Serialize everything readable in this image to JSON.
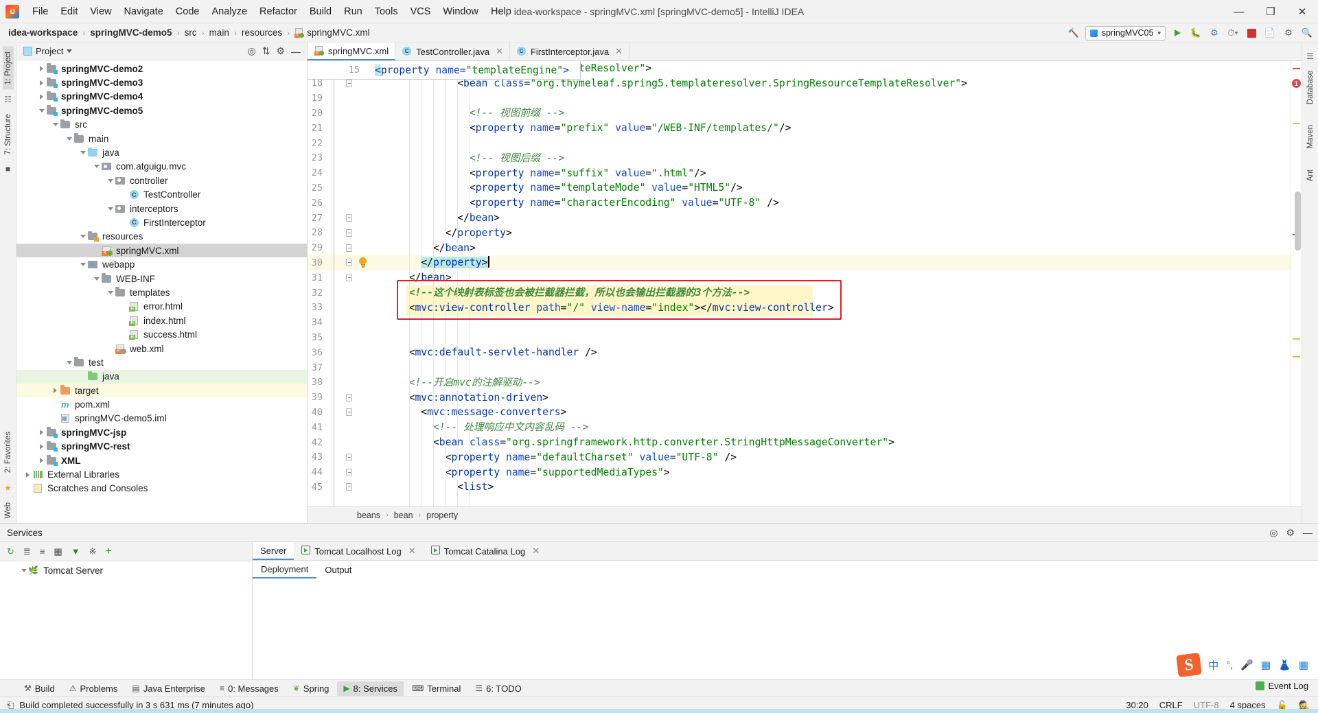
{
  "window": {
    "title": "idea-workspace - springMVC.xml [springMVC-demo5] - IntelliJ IDEA",
    "minimize": "—",
    "maximize": "❐",
    "close": "✕"
  },
  "menu": [
    "File",
    "Edit",
    "View",
    "Navigate",
    "Code",
    "Analyze",
    "Refactor",
    "Build",
    "Run",
    "Tools",
    "VCS",
    "Window",
    "Help"
  ],
  "breadcrumb": {
    "items": [
      "idea-workspace",
      "springMVC-demo5",
      "src",
      "main",
      "resources",
      "springMVC.xml"
    ],
    "separator": "›"
  },
  "run_config": {
    "name": "springMVC05",
    "chevron": "▾"
  },
  "left_strip": {
    "project_tab": "1: Project",
    "structure_tab": "7: Structure",
    "favorites_tab": "2: Favorites",
    "web_tab": "Web"
  },
  "right_strip": {
    "database_tab": "Database",
    "maven_tab": "Maven",
    "ant_tab": "Ant"
  },
  "project_panel": {
    "title": "Project",
    "tree": [
      {
        "label": "springMVC-demo2",
        "indent": 1,
        "arrow": "right",
        "icon": "module-folder",
        "bold": true,
        "state": ""
      },
      {
        "label": "springMVC-demo3",
        "indent": 1,
        "arrow": "right",
        "icon": "module-folder",
        "bold": true,
        "state": ""
      },
      {
        "label": "springMVC-demo4",
        "indent": 1,
        "arrow": "right",
        "icon": "module-folder",
        "bold": true,
        "state": ""
      },
      {
        "label": "springMVC-demo5",
        "indent": 1,
        "arrow": "down",
        "icon": "module-folder",
        "bold": true,
        "state": ""
      },
      {
        "label": "src",
        "indent": 2,
        "arrow": "down",
        "icon": "folder-gray",
        "bold": false,
        "state": ""
      },
      {
        "label": "main",
        "indent": 3,
        "arrow": "down",
        "icon": "folder-gray",
        "bold": false,
        "state": ""
      },
      {
        "label": "java",
        "indent": 4,
        "arrow": "down",
        "icon": "folder-blue",
        "bold": false,
        "state": ""
      },
      {
        "label": "com.atguigu.mvc",
        "indent": 5,
        "arrow": "down",
        "icon": "package",
        "bold": false,
        "state": ""
      },
      {
        "label": "controller",
        "indent": 6,
        "arrow": "down",
        "icon": "package",
        "bold": false,
        "state": ""
      },
      {
        "label": "TestController",
        "indent": 7,
        "arrow": "none",
        "icon": "class",
        "bold": false,
        "state": ""
      },
      {
        "label": "interceptors",
        "indent": 6,
        "arrow": "down",
        "icon": "package",
        "bold": false,
        "state": ""
      },
      {
        "label": "FirstInterceptor",
        "indent": 7,
        "arrow": "none",
        "icon": "class",
        "bold": false,
        "state": ""
      },
      {
        "label": "resources",
        "indent": 4,
        "arrow": "down",
        "icon": "folder-res",
        "bold": false,
        "state": ""
      },
      {
        "label": "springMVC.xml",
        "indent": 5,
        "arrow": "none",
        "icon": "xml-spring",
        "bold": false,
        "state": "selected"
      },
      {
        "label": "webapp",
        "indent": 4,
        "arrow": "down",
        "icon": "folder-web",
        "bold": false,
        "state": ""
      },
      {
        "label": "WEB-INF",
        "indent": 5,
        "arrow": "down",
        "icon": "folder-gray",
        "bold": false,
        "state": ""
      },
      {
        "label": "templates",
        "indent": 6,
        "arrow": "down",
        "icon": "folder-gray",
        "bold": false,
        "state": ""
      },
      {
        "label": "error.html",
        "indent": 7,
        "arrow": "none",
        "icon": "html",
        "bold": false,
        "state": ""
      },
      {
        "label": "index.html",
        "indent": 7,
        "arrow": "none",
        "icon": "html",
        "bold": false,
        "state": ""
      },
      {
        "label": "success.html",
        "indent": 7,
        "arrow": "none",
        "icon": "html",
        "bold": false,
        "state": ""
      },
      {
        "label": "web.xml",
        "indent": 6,
        "arrow": "none",
        "icon": "xml-web",
        "bold": false,
        "state": ""
      },
      {
        "label": "test",
        "indent": 3,
        "arrow": "down",
        "icon": "folder-gray",
        "bold": false,
        "state": ""
      },
      {
        "label": "java",
        "indent": 4,
        "arrow": "none",
        "icon": "folder-green",
        "bold": false,
        "state": "green"
      },
      {
        "label": "target",
        "indent": 2,
        "arrow": "right",
        "icon": "folder-orange",
        "bold": false,
        "state": "yellow"
      },
      {
        "label": "pom.xml",
        "indent": 2,
        "arrow": "none",
        "icon": "maven",
        "bold": false,
        "state": ""
      },
      {
        "label": "springMVC-demo5.iml",
        "indent": 2,
        "arrow": "none",
        "icon": "iml",
        "bold": false,
        "state": ""
      },
      {
        "label": "springMVC-jsp",
        "indent": 1,
        "arrow": "right",
        "icon": "module-folder",
        "bold": true,
        "state": ""
      },
      {
        "label": "springMVC-rest",
        "indent": 1,
        "arrow": "right",
        "icon": "module-folder",
        "bold": true,
        "state": ""
      },
      {
        "label": "XML",
        "indent": 1,
        "arrow": "right",
        "icon": "module-folder",
        "bold": true,
        "state": ""
      },
      {
        "label": "External Libraries",
        "indent": 0,
        "arrow": "right",
        "icon": "libraries",
        "bold": false,
        "state": ""
      },
      {
        "label": "Scratches and Consoles",
        "indent": 0,
        "arrow": "none",
        "icon": "scratch",
        "bold": false,
        "state": ""
      }
    ]
  },
  "editor": {
    "tabs": [
      {
        "label": "springMVC.xml",
        "icon": "xml-spring",
        "active": true,
        "closable": false
      },
      {
        "label": "TestController.java",
        "icon": "class",
        "active": false,
        "closable": true
      },
      {
        "label": "FirstInterceptor.java",
        "icon": "class",
        "active": false,
        "closable": true
      }
    ],
    "sticky_line": {
      "number": "15",
      "text": "<property name=\"templateEngine\">"
    },
    "lines": [
      {
        "n": "17",
        "indent": 8,
        "tokens": [
          [
            "punct",
            "<"
          ],
          [
            "tag",
            "property"
          ],
          [
            "sp",
            " "
          ],
          [
            "attr",
            "name"
          ],
          [
            "punct",
            "="
          ],
          [
            "val",
            "\"templateResolver\""
          ],
          [
            "punct",
            ">"
          ]
        ]
      },
      {
        "n": "18",
        "indent": 10,
        "tokens": [
          [
            "punct",
            "<"
          ],
          [
            "tag",
            "bean"
          ],
          [
            "sp",
            " "
          ],
          [
            "attr",
            "class"
          ],
          [
            "punct",
            "="
          ],
          [
            "val",
            "\"org.thymeleaf.spring5.templateresolver.SpringResourceTemplateResolver\""
          ],
          [
            "punct",
            ">"
          ]
        ]
      },
      {
        "n": "19",
        "indent": 0,
        "tokens": []
      },
      {
        "n": "20",
        "indent": 12,
        "tokens": [
          [
            "cmt",
            "<!-- 视图前缀 -->"
          ]
        ]
      },
      {
        "n": "21",
        "indent": 12,
        "tokens": [
          [
            "punct",
            "<"
          ],
          [
            "tag",
            "property"
          ],
          [
            "sp",
            " "
          ],
          [
            "attr",
            "name"
          ],
          [
            "punct",
            "="
          ],
          [
            "val",
            "\"prefix\""
          ],
          [
            "sp",
            " "
          ],
          [
            "attr",
            "value"
          ],
          [
            "punct",
            "="
          ],
          [
            "val",
            "\"/WEB-INF/templates/\""
          ],
          [
            "punct",
            "/>"
          ]
        ]
      },
      {
        "n": "22",
        "indent": 0,
        "tokens": []
      },
      {
        "n": "23",
        "indent": 12,
        "tokens": [
          [
            "cmt",
            "<!-- 视图后缀 -->"
          ]
        ]
      },
      {
        "n": "24",
        "indent": 12,
        "tokens": [
          [
            "punct",
            "<"
          ],
          [
            "tag",
            "property"
          ],
          [
            "sp",
            " "
          ],
          [
            "attr",
            "name"
          ],
          [
            "punct",
            "="
          ],
          [
            "val",
            "\"suffix\""
          ],
          [
            "sp",
            " "
          ],
          [
            "attr",
            "value"
          ],
          [
            "punct",
            "="
          ],
          [
            "val",
            "\".html\""
          ],
          [
            "punct",
            "/>"
          ]
        ]
      },
      {
        "n": "25",
        "indent": 12,
        "tokens": [
          [
            "punct",
            "<"
          ],
          [
            "tag",
            "property"
          ],
          [
            "sp",
            " "
          ],
          [
            "attr",
            "name"
          ],
          [
            "punct",
            "="
          ],
          [
            "val",
            "\"templateMode\""
          ],
          [
            "sp",
            " "
          ],
          [
            "attr",
            "value"
          ],
          [
            "punct",
            "="
          ],
          [
            "val",
            "\"HTML5\""
          ],
          [
            "punct",
            "/>"
          ]
        ]
      },
      {
        "n": "26",
        "indent": 12,
        "tokens": [
          [
            "punct",
            "<"
          ],
          [
            "tag",
            "property"
          ],
          [
            "sp",
            " "
          ],
          [
            "attr",
            "name"
          ],
          [
            "punct",
            "="
          ],
          [
            "val",
            "\"characterEncoding\""
          ],
          [
            "sp",
            " "
          ],
          [
            "attr",
            "value"
          ],
          [
            "punct",
            "="
          ],
          [
            "val",
            "\"UTF-8\""
          ],
          [
            "sp",
            " "
          ],
          [
            "punct",
            "/>"
          ]
        ]
      },
      {
        "n": "27",
        "indent": 10,
        "tokens": [
          [
            "punct",
            "</"
          ],
          [
            "tag",
            "bean"
          ],
          [
            "punct",
            ">"
          ]
        ]
      },
      {
        "n": "28",
        "indent": 8,
        "tokens": [
          [
            "punct",
            "</"
          ],
          [
            "tag",
            "property"
          ],
          [
            "punct",
            ">"
          ]
        ]
      },
      {
        "n": "29",
        "indent": 6,
        "tokens": [
          [
            "punct",
            "</"
          ],
          [
            "tag",
            "bean"
          ],
          [
            "punct",
            ">"
          ]
        ]
      },
      {
        "n": "30",
        "indent": 4,
        "tokens": [
          [
            "punct",
            "</"
          ],
          [
            "tag",
            "property"
          ],
          [
            "punct",
            ">"
          ]
        ],
        "current": true,
        "selected": true
      },
      {
        "n": "31",
        "indent": 2,
        "tokens": [
          [
            "punct",
            "</"
          ],
          [
            "tag",
            "bean"
          ],
          [
            "punct",
            ">"
          ]
        ]
      },
      {
        "n": "32",
        "indent": 2,
        "tokens": [
          [
            "cmtb",
            "<!--这个映射表标签也会被拦截器拦截，所以也会输出拦截器的3个方法-->"
          ]
        ],
        "boxed": true
      },
      {
        "n": "33",
        "indent": 2,
        "tokens": [
          [
            "punct",
            "<"
          ],
          [
            "tag",
            "mvc:view-controller"
          ],
          [
            "sp",
            " "
          ],
          [
            "attr",
            "path"
          ],
          [
            "punct",
            "="
          ],
          [
            "val",
            "\"/\""
          ],
          [
            "sp",
            " "
          ],
          [
            "attr",
            "view-name"
          ],
          [
            "punct",
            "="
          ],
          [
            "val",
            "\"index\""
          ],
          [
            "punct",
            ">"
          ],
          [
            "punct",
            "</"
          ],
          [
            "tag",
            "mvc:view-controller"
          ],
          [
            "punct",
            ">"
          ]
        ],
        "boxed": true
      },
      {
        "n": "34",
        "indent": 0,
        "tokens": []
      },
      {
        "n": "35",
        "indent": 0,
        "tokens": []
      },
      {
        "n": "36",
        "indent": 2,
        "tokens": [
          [
            "punct",
            "<"
          ],
          [
            "tag",
            "mvc:default-servlet-handler"
          ],
          [
            "sp",
            " "
          ],
          [
            "punct",
            "/>"
          ]
        ]
      },
      {
        "n": "37",
        "indent": 0,
        "tokens": []
      },
      {
        "n": "38",
        "indent": 2,
        "tokens": [
          [
            "cmt",
            "<!--开启mvc的注解驱动-->"
          ]
        ]
      },
      {
        "n": "39",
        "indent": 2,
        "tokens": [
          [
            "punct",
            "<"
          ],
          [
            "tag",
            "mvc:annotation-driven"
          ],
          [
            "punct",
            ">"
          ]
        ]
      },
      {
        "n": "40",
        "indent": 4,
        "tokens": [
          [
            "punct",
            "<"
          ],
          [
            "tag",
            "mvc:message-converters"
          ],
          [
            "punct",
            ">"
          ]
        ]
      },
      {
        "n": "41",
        "indent": 6,
        "tokens": [
          [
            "cmt",
            "<!-- 处理响应中文内容乱码 -->"
          ]
        ]
      },
      {
        "n": "42",
        "indent": 6,
        "tokens": [
          [
            "punct",
            "<"
          ],
          [
            "tag",
            "bean"
          ],
          [
            "sp",
            " "
          ],
          [
            "attr",
            "class"
          ],
          [
            "punct",
            "="
          ],
          [
            "val",
            "\"org.springframework.http.converter.StringHttpMessageConverter\""
          ],
          [
            "punct",
            ">"
          ]
        ]
      },
      {
        "n": "43",
        "indent": 8,
        "tokens": [
          [
            "punct",
            "<"
          ],
          [
            "tag",
            "property"
          ],
          [
            "sp",
            " "
          ],
          [
            "attr",
            "name"
          ],
          [
            "punct",
            "="
          ],
          [
            "val",
            "\"defaultCharset\""
          ],
          [
            "sp",
            " "
          ],
          [
            "attr",
            "value"
          ],
          [
            "punct",
            "="
          ],
          [
            "val",
            "\"UTF-8\""
          ],
          [
            "sp",
            " "
          ],
          [
            "punct",
            "/>"
          ]
        ]
      },
      {
        "n": "44",
        "indent": 8,
        "tokens": [
          [
            "punct",
            "<"
          ],
          [
            "tag",
            "property"
          ],
          [
            "sp",
            " "
          ],
          [
            "attr",
            "name"
          ],
          [
            "punct",
            "="
          ],
          [
            "val",
            "\"supportedMediaTypes\""
          ],
          [
            "punct",
            ">"
          ]
        ]
      },
      {
        "n": "45",
        "indent": 10,
        "tokens": [
          [
            "punct",
            "<"
          ],
          [
            "tag",
            "list"
          ],
          [
            "punct",
            ">"
          ]
        ]
      }
    ],
    "breadcrumbs": {
      "items": [
        "beans",
        "bean",
        "property"
      ],
      "separator": "›"
    }
  },
  "services": {
    "title": "Services",
    "left_tree_root": "Tomcat Server",
    "tabs": [
      {
        "label": "Server",
        "icon": "none",
        "active": true
      },
      {
        "label": "Tomcat Localhost Log",
        "icon": "run",
        "active": false,
        "closable": true
      },
      {
        "label": "Tomcat Catalina Log",
        "icon": "run",
        "active": false,
        "closable": true
      }
    ],
    "sub_tabs": [
      {
        "label": "Deployment",
        "active": true
      },
      {
        "label": "Output",
        "active": false
      }
    ]
  },
  "tool_window_bar": [
    {
      "label": "Build",
      "icon": "hammer-icon",
      "active": false
    },
    {
      "label": "Problems",
      "icon": "warning-icon",
      "active": false
    },
    {
      "label": "Java Enterprise",
      "icon": "enterprise-icon",
      "active": false
    },
    {
      "label": "0: Messages",
      "icon": "messages-icon",
      "active": false
    },
    {
      "label": "Spring",
      "icon": "spring-leaf-icon",
      "active": false
    },
    {
      "label": "8: Services",
      "icon": "services-icon",
      "active": true
    },
    {
      "label": "Terminal",
      "icon": "terminal-icon",
      "active": false
    },
    {
      "label": "6: TODO",
      "icon": "todo-icon",
      "active": false
    }
  ],
  "status_bar": {
    "message": "Build completed successfully in 3 s 631 ms (7 minutes ago)",
    "caret_position": "30:20",
    "line_separator": "CRLF",
    "encoding": "UTF-8",
    "indent": "4 spaces",
    "event_log": "Event Log"
  },
  "colors": {
    "accent": "#4a90d9",
    "highlight_box": "#e02020",
    "selection": "#b8e8e8",
    "current_line": "#fcfae4",
    "comment": "#3f8a3f",
    "tag": "#0033b3",
    "value": "#008000"
  }
}
